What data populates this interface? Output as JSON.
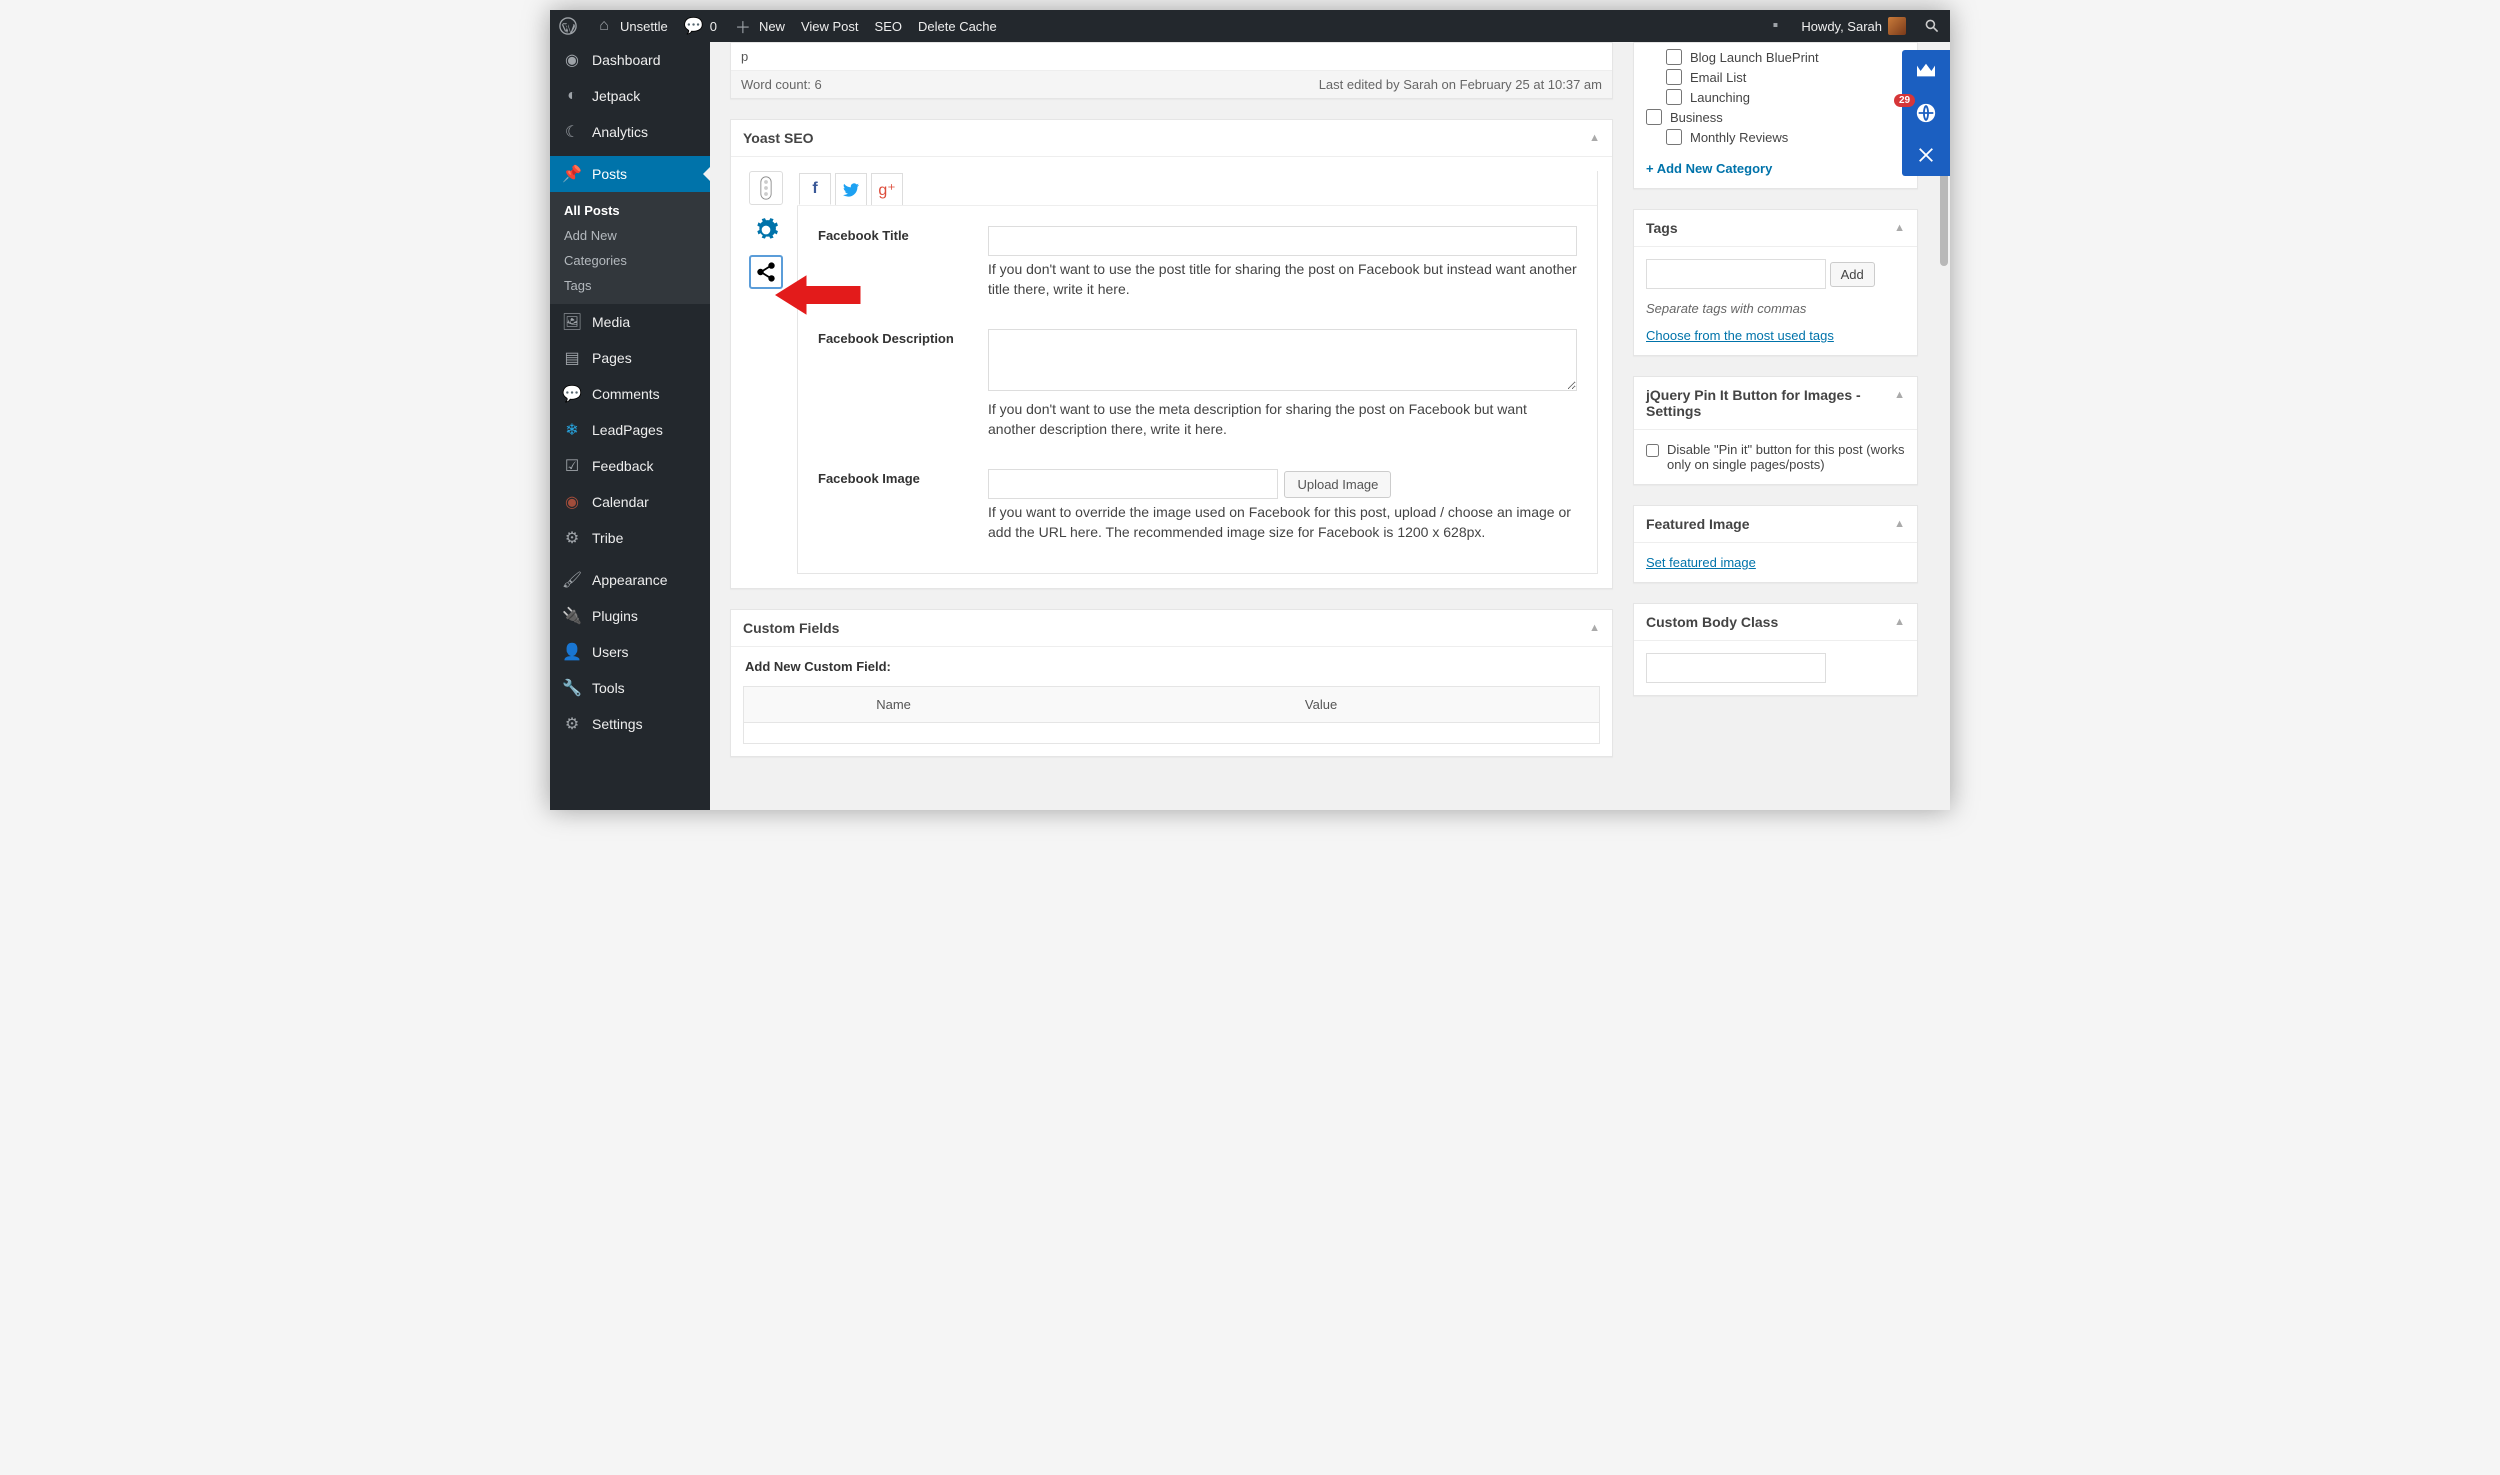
{
  "adminbar": {
    "site_name": "Unsettle",
    "comments_count": "0",
    "new_label": "New",
    "view_post": "View Post",
    "seo": "SEO",
    "delete_cache": "Delete Cache",
    "howdy": "Howdy, Sarah"
  },
  "sidebar": {
    "dashboard": "Dashboard",
    "jetpack": "Jetpack",
    "analytics": "Analytics",
    "posts": "Posts",
    "posts_submenu": {
      "all": "All Posts",
      "add": "Add New",
      "categories": "Categories",
      "tags": "Tags"
    },
    "media": "Media",
    "pages": "Pages",
    "comments": "Comments",
    "leadpages": "LeadPages",
    "feedback": "Feedback",
    "calendar": "Calendar",
    "tribe": "Tribe",
    "appearance": "Appearance",
    "plugins": "Plugins",
    "users": "Users",
    "tools": "Tools",
    "settings": "Settings"
  },
  "editor": {
    "path": "p",
    "word_count_label": "Word count: 6",
    "last_edited": "Last edited by Sarah on February 25 at 10:37 am"
  },
  "yoast": {
    "title": "Yoast SEO",
    "fb_title_label": "Facebook Title",
    "fb_title_help": "If you don't want to use the post title for sharing the post on Facebook but instead want another title there, write it here.",
    "fb_desc_label": "Facebook Description",
    "fb_desc_help": "If you don't want to use the meta description for sharing the post on Facebook but want another description there, write it here.",
    "fb_image_label": "Facebook Image",
    "upload_btn": "Upload Image",
    "fb_image_help": "If you want to override the image used on Facebook for this post, upload / choose an image or add the URL here. The recommended image size for Facebook is 1200 x 628px."
  },
  "custom_fields": {
    "title": "Custom Fields",
    "add_new_label": "Add New Custom Field:",
    "th_name": "Name",
    "th_value": "Value"
  },
  "categories_box": {
    "cats": [
      "Blog Launch BluePrint",
      "Email List",
      "Launching"
    ],
    "parent": "Business",
    "monthly": "Monthly Reviews",
    "add_new": "+ Add New Category"
  },
  "tags_box": {
    "title": "Tags",
    "add_btn": "Add",
    "hint": "Separate tags with commas",
    "choose": "Choose from the most used tags"
  },
  "pinit_box": {
    "title": "jQuery Pin It Button for Images - Settings",
    "text": "Disable \"Pin it\" button for this post (works only on single pages/posts)"
  },
  "featured_box": {
    "title": "Featured Image",
    "link": "Set featured image"
  },
  "bodyclass_box": {
    "title": "Custom Body Class"
  },
  "floaty": {
    "badge": "29"
  }
}
